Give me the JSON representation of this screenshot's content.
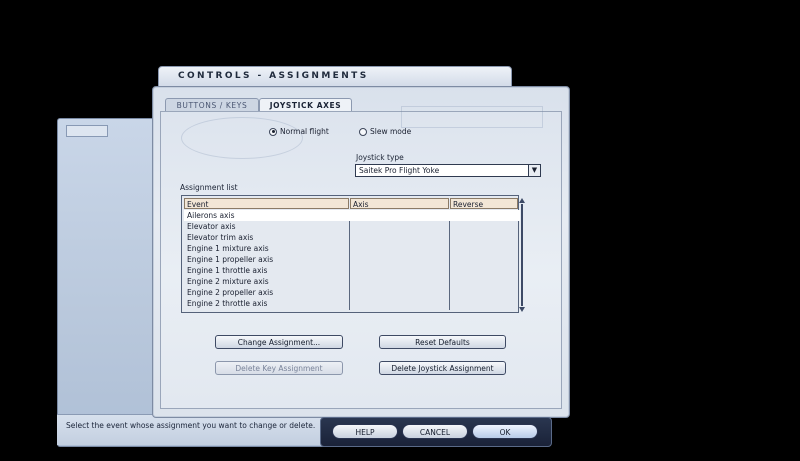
{
  "title": "CONTROLS - ASSIGNMENTS",
  "tabs": {
    "buttons_keys": "BUTTONS / KEYS",
    "joystick_axes": "JOYSTICK AXES"
  },
  "mode": {
    "normal": "Normal flight",
    "slew": "Slew mode",
    "selected": "Normal flight"
  },
  "joystick": {
    "label": "Joystick type",
    "value": "Saitek Pro Flight Yoke"
  },
  "assignment": {
    "label": "Assignment list",
    "columns": [
      "Event",
      "Axis",
      "Reverse"
    ],
    "rows": [
      "Ailerons axis",
      "Elevator axis",
      "Elevator trim axis",
      "Engine 1 mixture axis",
      "Engine 1 propeller axis",
      "Engine 1 throttle axis",
      "Engine 2 mixture axis",
      "Engine 2 propeller axis",
      "Engine 2 throttle axis"
    ],
    "selected_row": "Ailerons axis"
  },
  "buttons": {
    "change": "Change Assignment...",
    "reset": "Reset Defaults",
    "delete_key": "Delete Key Assignment",
    "delete_joystick": "Delete Joystick Assignment"
  },
  "footer": {
    "help": "HELP",
    "cancel": "CANCEL",
    "ok": "OK"
  },
  "status": "Select the event whose assignment you want to change or delete.",
  "colors": {
    "header_fill": "#f2e6d6",
    "panel": "#dde4ee",
    "accent": "#3d4a66"
  }
}
